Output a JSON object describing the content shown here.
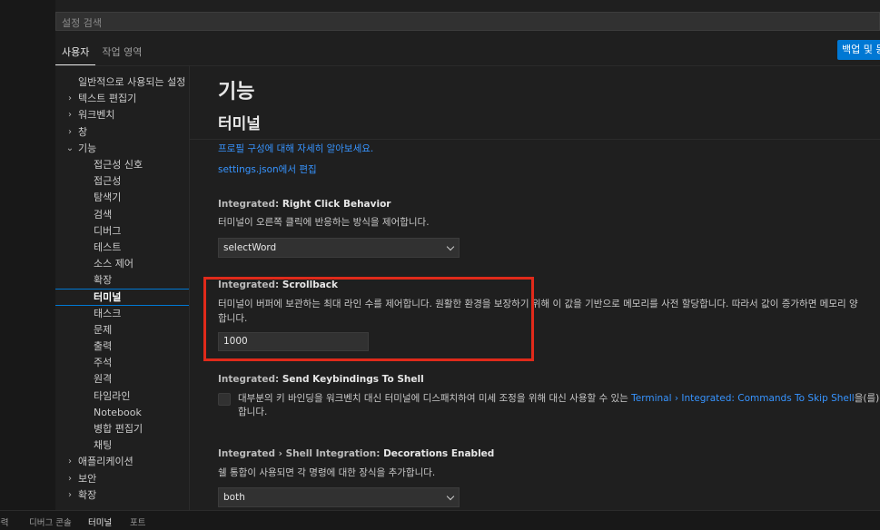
{
  "search": {
    "placeholder": "설정 검색"
  },
  "scope_tabs": [
    {
      "label": "사용자",
      "active": true
    },
    {
      "label": "작업 영역",
      "active": false
    }
  ],
  "backup_button": "백업 및 동",
  "toc": [
    {
      "label": "일반적으로 사용되는 설정",
      "level": 0,
      "chevron": ""
    },
    {
      "label": "텍스트 편집기",
      "level": 0,
      "chevron": "›"
    },
    {
      "label": "워크벤치",
      "level": 0,
      "chevron": "›"
    },
    {
      "label": "창",
      "level": 0,
      "chevron": "›"
    },
    {
      "label": "기능",
      "level": 0,
      "chevron": "⌄"
    },
    {
      "label": "접근성 신호",
      "level": 1
    },
    {
      "label": "접근성",
      "level": 1
    },
    {
      "label": "탐색기",
      "level": 1
    },
    {
      "label": "검색",
      "level": 1
    },
    {
      "label": "디버그",
      "level": 1
    },
    {
      "label": "테스트",
      "level": 1
    },
    {
      "label": "소스 제어",
      "level": 1
    },
    {
      "label": "확장",
      "level": 1
    },
    {
      "label": "터미널",
      "level": 1,
      "active": true
    },
    {
      "label": "태스크",
      "level": 1
    },
    {
      "label": "문제",
      "level": 1
    },
    {
      "label": "출력",
      "level": 1
    },
    {
      "label": "주석",
      "level": 1
    },
    {
      "label": "원격",
      "level": 1
    },
    {
      "label": "타임라인",
      "level": 1
    },
    {
      "label": "Notebook",
      "level": 1
    },
    {
      "label": "병합 편집기",
      "level": 1
    },
    {
      "label": "채팅",
      "level": 1
    },
    {
      "label": "애플리케이션",
      "level": 0,
      "chevron": "›"
    },
    {
      "label": "보안",
      "level": 0,
      "chevron": "›"
    },
    {
      "label": "확장",
      "level": 0,
      "chevron": "›"
    }
  ],
  "content": {
    "group_title": "기능",
    "section_title": "터미널",
    "profile_link": "프로필 구성에 대해 자세히 알아보세요.",
    "settings_json_link": "settings.json에서 편집",
    "right_click": {
      "category": "Integrated: ",
      "name": "Right Click Behavior",
      "description": "터미널이 오른쪽 클릭에 반응하는 방식을 제어합니다.",
      "value": "selectWord"
    },
    "scrollback": {
      "category": "Integrated: ",
      "name": "Scrollback",
      "description_line1": "터미널이 버퍼에 보관하는 최대 라인 수를 제어합니다. 원활한 환경을 보장하기 위해 이 값을 기반으로 메모리를 사전 할당합니다. 따라서 값이 증가하면 메모리 양",
      "description_line2": "합니다.",
      "value": "1000"
    },
    "send_keybindings": {
      "category": "Integrated: ",
      "name": "Send Keybindings To Shell",
      "description_pre": "대부분의 키 바인딩을 워크벤치 대신 터미널에 디스패치하여 미세 조정을 위해 대신 사용할 수 있는 ",
      "description_link": "Terminal › Integrated: Commands To Skip Shell",
      "description_post": "을(를)",
      "description_line2": "합니다.",
      "checked": false
    },
    "shell_integration": {
      "category": "Integrated › Shell Integration: ",
      "name": "Decorations Enabled",
      "description": "쉘 통합이 사용되면 각 명령에 대한 장식을 추가합니다.",
      "value": "both"
    }
  },
  "panel_tabs": [
    {
      "label": "출력",
      "active": false
    },
    {
      "label": "디버그 콘솔",
      "active": false
    },
    {
      "label": "터미널",
      "active": true
    },
    {
      "label": "포트",
      "active": false
    }
  ],
  "colors": {
    "accent": "#0078d4",
    "highlight_box": "#e02a1a",
    "link": "#3794ff",
    "background": "#1f1f1f"
  }
}
